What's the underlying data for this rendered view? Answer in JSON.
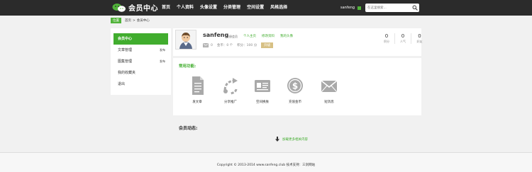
{
  "header": {
    "logo_text": "会员中心",
    "nav": [
      "首页",
      "个人资料",
      "头像设置",
      "分类管理",
      "空间设置",
      "风格选择"
    ],
    "username": "sanfeng",
    "search_placeholder": "在这里搜索..."
  },
  "breadcrumb": {
    "badge": "位置",
    "items": [
      "首页",
      ">",
      "会员中心"
    ]
  },
  "sidebar": {
    "items": [
      {
        "label": "会员中心",
        "tag": ""
      },
      {
        "label": "文章管理",
        "tag": "发布"
      },
      {
        "label": "图集管理",
        "tag": "发布"
      },
      {
        "label": "我的收藏夹",
        "tag": ""
      },
      {
        "label": "退出",
        "tag": ""
      }
    ]
  },
  "profile": {
    "name": "sanfeng",
    "group": "注册会员",
    "links": [
      "个人主页",
      "修改资料",
      "我的头像"
    ],
    "msgs": "0",
    "coins": "金币：0 个",
    "score": "积分：100 分",
    "upgrade": "升级",
    "stats": [
      {
        "value": "0",
        "label": "积分"
      },
      {
        "value": "0",
        "label": "人气"
      },
      {
        "value": "0",
        "label": "好友"
      }
    ]
  },
  "functions": {
    "title": "常用功能:",
    "items": [
      "发文章",
      "分享推广",
      "空间换肤",
      "充值金币",
      "短消息"
    ]
  },
  "activity": {
    "title": "会员动态:",
    "load_more": "加载更多相关内容"
  },
  "footer": {
    "text": "Copyright © 2013-2014 www.sanfeng.club 技术支持：三剑网站"
  },
  "colors": {
    "accent": "#41ad2e",
    "topbar": "#2b2b2b"
  }
}
